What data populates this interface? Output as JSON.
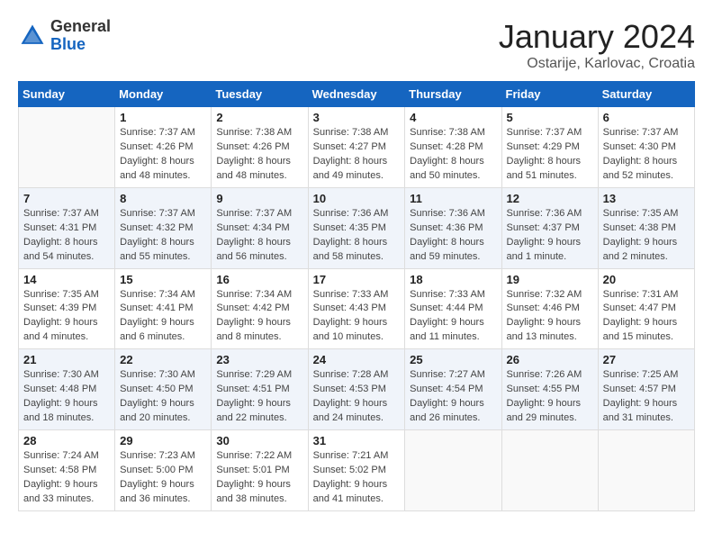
{
  "header": {
    "logo_general": "General",
    "logo_blue": "Blue",
    "month": "January 2024",
    "location": "Ostarije, Karlovac, Croatia"
  },
  "days_of_week": [
    "Sunday",
    "Monday",
    "Tuesday",
    "Wednesday",
    "Thursday",
    "Friday",
    "Saturday"
  ],
  "weeks": [
    [
      {
        "day": "",
        "info": ""
      },
      {
        "day": "1",
        "info": "Sunrise: 7:37 AM\nSunset: 4:26 PM\nDaylight: 8 hours\nand 48 minutes."
      },
      {
        "day": "2",
        "info": "Sunrise: 7:38 AM\nSunset: 4:26 PM\nDaylight: 8 hours\nand 48 minutes."
      },
      {
        "day": "3",
        "info": "Sunrise: 7:38 AM\nSunset: 4:27 PM\nDaylight: 8 hours\nand 49 minutes."
      },
      {
        "day": "4",
        "info": "Sunrise: 7:38 AM\nSunset: 4:28 PM\nDaylight: 8 hours\nand 50 minutes."
      },
      {
        "day": "5",
        "info": "Sunrise: 7:37 AM\nSunset: 4:29 PM\nDaylight: 8 hours\nand 51 minutes."
      },
      {
        "day": "6",
        "info": "Sunrise: 7:37 AM\nSunset: 4:30 PM\nDaylight: 8 hours\nand 52 minutes."
      }
    ],
    [
      {
        "day": "7",
        "info": "Sunrise: 7:37 AM\nSunset: 4:31 PM\nDaylight: 8 hours\nand 54 minutes."
      },
      {
        "day": "8",
        "info": "Sunrise: 7:37 AM\nSunset: 4:32 PM\nDaylight: 8 hours\nand 55 minutes."
      },
      {
        "day": "9",
        "info": "Sunrise: 7:37 AM\nSunset: 4:34 PM\nDaylight: 8 hours\nand 56 minutes."
      },
      {
        "day": "10",
        "info": "Sunrise: 7:36 AM\nSunset: 4:35 PM\nDaylight: 8 hours\nand 58 minutes."
      },
      {
        "day": "11",
        "info": "Sunrise: 7:36 AM\nSunset: 4:36 PM\nDaylight: 8 hours\nand 59 minutes."
      },
      {
        "day": "12",
        "info": "Sunrise: 7:36 AM\nSunset: 4:37 PM\nDaylight: 9 hours\nand 1 minute."
      },
      {
        "day": "13",
        "info": "Sunrise: 7:35 AM\nSunset: 4:38 PM\nDaylight: 9 hours\nand 2 minutes."
      }
    ],
    [
      {
        "day": "14",
        "info": "Sunrise: 7:35 AM\nSunset: 4:39 PM\nDaylight: 9 hours\nand 4 minutes."
      },
      {
        "day": "15",
        "info": "Sunrise: 7:34 AM\nSunset: 4:41 PM\nDaylight: 9 hours\nand 6 minutes."
      },
      {
        "day": "16",
        "info": "Sunrise: 7:34 AM\nSunset: 4:42 PM\nDaylight: 9 hours\nand 8 minutes."
      },
      {
        "day": "17",
        "info": "Sunrise: 7:33 AM\nSunset: 4:43 PM\nDaylight: 9 hours\nand 10 minutes."
      },
      {
        "day": "18",
        "info": "Sunrise: 7:33 AM\nSunset: 4:44 PM\nDaylight: 9 hours\nand 11 minutes."
      },
      {
        "day": "19",
        "info": "Sunrise: 7:32 AM\nSunset: 4:46 PM\nDaylight: 9 hours\nand 13 minutes."
      },
      {
        "day": "20",
        "info": "Sunrise: 7:31 AM\nSunset: 4:47 PM\nDaylight: 9 hours\nand 15 minutes."
      }
    ],
    [
      {
        "day": "21",
        "info": "Sunrise: 7:30 AM\nSunset: 4:48 PM\nDaylight: 9 hours\nand 18 minutes."
      },
      {
        "day": "22",
        "info": "Sunrise: 7:30 AM\nSunset: 4:50 PM\nDaylight: 9 hours\nand 20 minutes."
      },
      {
        "day": "23",
        "info": "Sunrise: 7:29 AM\nSunset: 4:51 PM\nDaylight: 9 hours\nand 22 minutes."
      },
      {
        "day": "24",
        "info": "Sunrise: 7:28 AM\nSunset: 4:53 PM\nDaylight: 9 hours\nand 24 minutes."
      },
      {
        "day": "25",
        "info": "Sunrise: 7:27 AM\nSunset: 4:54 PM\nDaylight: 9 hours\nand 26 minutes."
      },
      {
        "day": "26",
        "info": "Sunrise: 7:26 AM\nSunset: 4:55 PM\nDaylight: 9 hours\nand 29 minutes."
      },
      {
        "day": "27",
        "info": "Sunrise: 7:25 AM\nSunset: 4:57 PM\nDaylight: 9 hours\nand 31 minutes."
      }
    ],
    [
      {
        "day": "28",
        "info": "Sunrise: 7:24 AM\nSunset: 4:58 PM\nDaylight: 9 hours\nand 33 minutes."
      },
      {
        "day": "29",
        "info": "Sunrise: 7:23 AM\nSunset: 5:00 PM\nDaylight: 9 hours\nand 36 minutes."
      },
      {
        "day": "30",
        "info": "Sunrise: 7:22 AM\nSunset: 5:01 PM\nDaylight: 9 hours\nand 38 minutes."
      },
      {
        "day": "31",
        "info": "Sunrise: 7:21 AM\nSunset: 5:02 PM\nDaylight: 9 hours\nand 41 minutes."
      },
      {
        "day": "",
        "info": ""
      },
      {
        "day": "",
        "info": ""
      },
      {
        "day": "",
        "info": ""
      }
    ]
  ]
}
